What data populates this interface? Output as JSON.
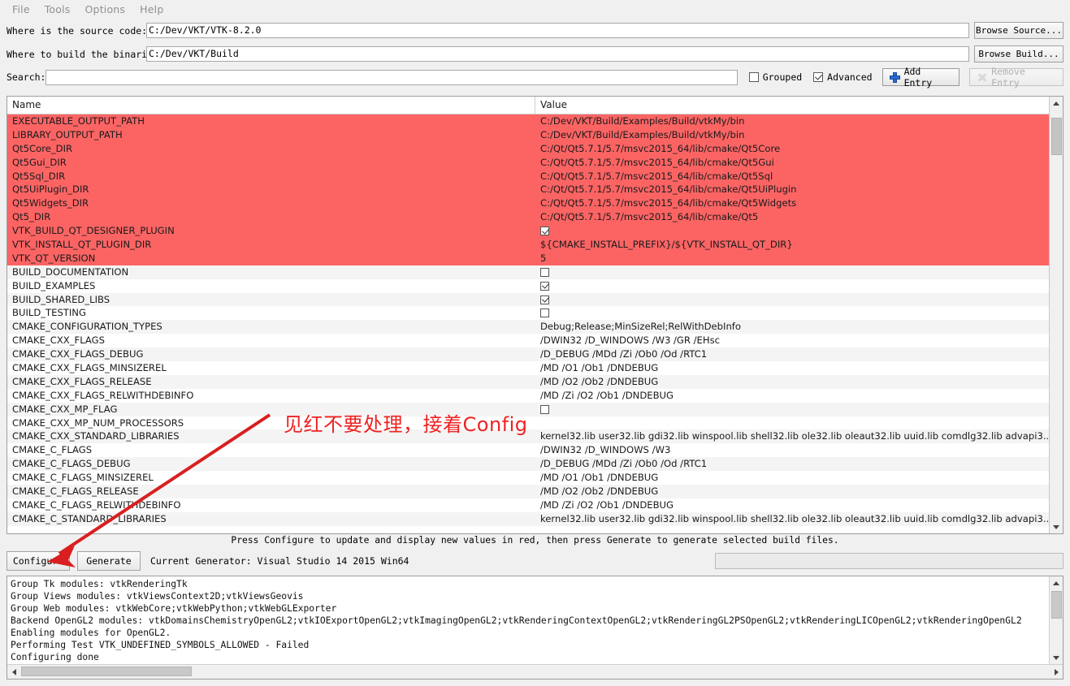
{
  "menu": {
    "items": [
      {
        "label": "File"
      },
      {
        "label": "Tools"
      },
      {
        "label": "Options"
      },
      {
        "label": "Help"
      }
    ]
  },
  "paths": {
    "source": {
      "label": "Where is the source code:",
      "value": "C:/Dev/VKT/VTK-8.2.0",
      "placeholder": "",
      "browse_label": "Browse Source..."
    },
    "build": {
      "label": "Where to build the binaries:",
      "value": "C:/Dev/VKT/Build",
      "placeholder": "",
      "browse_label": "Browse Build..."
    }
  },
  "search": {
    "label": "Search:",
    "value": "",
    "placeholder": "",
    "grouped_label": "Grouped",
    "grouped_checked": false,
    "advanced_label": "Advanced",
    "advanced_checked": true,
    "add_entry_label": "Add Entry",
    "remove_entry_label": "Remove Entry"
  },
  "table": {
    "columns": [
      "Name",
      "Value"
    ],
    "rows": [
      {
        "name": "EXECUTABLE_OUTPUT_PATH",
        "value": "C:/Dev/VKT/Build/Examples/Build/vtkMy/bin",
        "type": "text",
        "red": true
      },
      {
        "name": "LIBRARY_OUTPUT_PATH",
        "value": "C:/Dev/VKT/Build/Examples/Build/vtkMy/bin",
        "type": "text",
        "red": true
      },
      {
        "name": "Qt5Core_DIR",
        "value": "C:/Qt/Qt5.7.1/5.7/msvc2015_64/lib/cmake/Qt5Core",
        "type": "text",
        "red": true
      },
      {
        "name": "Qt5Gui_DIR",
        "value": "C:/Qt/Qt5.7.1/5.7/msvc2015_64/lib/cmake/Qt5Gui",
        "type": "text",
        "red": true
      },
      {
        "name": "Qt5Sql_DIR",
        "value": "C:/Qt/Qt5.7.1/5.7/msvc2015_64/lib/cmake/Qt5Sql",
        "type": "text",
        "red": true
      },
      {
        "name": "Qt5UiPlugin_DIR",
        "value": "C:/Qt/Qt5.7.1/5.7/msvc2015_64/lib/cmake/Qt5UiPlugin",
        "type": "text",
        "red": true
      },
      {
        "name": "Qt5Widgets_DIR",
        "value": "C:/Qt/Qt5.7.1/5.7/msvc2015_64/lib/cmake/Qt5Widgets",
        "type": "text",
        "red": true
      },
      {
        "name": "Qt5_DIR",
        "value": "C:/Qt/Qt5.7.1/5.7/msvc2015_64/lib/cmake/Qt5",
        "type": "text",
        "red": true
      },
      {
        "name": "VTK_BUILD_QT_DESIGNER_PLUGIN",
        "value": "",
        "type": "checkbox",
        "checked": true,
        "red": true
      },
      {
        "name": "VTK_INSTALL_QT_PLUGIN_DIR",
        "value": "${CMAKE_INSTALL_PREFIX}/${VTK_INSTALL_QT_DIR}",
        "type": "text",
        "red": true
      },
      {
        "name": "VTK_QT_VERSION",
        "value": "5",
        "type": "text",
        "red": true
      },
      {
        "name": "BUILD_DOCUMENTATION",
        "value": "",
        "type": "checkbox",
        "checked": false,
        "red": false
      },
      {
        "name": "BUILD_EXAMPLES",
        "value": "",
        "type": "checkbox",
        "checked": true,
        "red": false
      },
      {
        "name": "BUILD_SHARED_LIBS",
        "value": "",
        "type": "checkbox",
        "checked": true,
        "red": false
      },
      {
        "name": "BUILD_TESTING",
        "value": "",
        "type": "checkbox",
        "checked": false,
        "red": false
      },
      {
        "name": "CMAKE_CONFIGURATION_TYPES",
        "value": "Debug;Release;MinSizeRel;RelWithDebInfo",
        "type": "text",
        "red": false
      },
      {
        "name": "CMAKE_CXX_FLAGS",
        "value": " /DWIN32 /D_WINDOWS /W3 /GR /EHsc",
        "type": "text",
        "red": false
      },
      {
        "name": "CMAKE_CXX_FLAGS_DEBUG",
        "value": "/D_DEBUG /MDd /Zi /Ob0 /Od /RTC1",
        "type": "text",
        "red": false
      },
      {
        "name": "CMAKE_CXX_FLAGS_MINSIZEREL",
        "value": "/MD /O1 /Ob1 /DNDEBUG",
        "type": "text",
        "red": false
      },
      {
        "name": "CMAKE_CXX_FLAGS_RELEASE",
        "value": "/MD /O2 /Ob2 /DNDEBUG",
        "type": "text",
        "red": false
      },
      {
        "name": "CMAKE_CXX_FLAGS_RELWITHDEBINFO",
        "value": "/MD /Zi /O2 /Ob1 /DNDEBUG",
        "type": "text",
        "red": false
      },
      {
        "name": "CMAKE_CXX_MP_FLAG",
        "value": "",
        "type": "checkbox",
        "checked": false,
        "red": false
      },
      {
        "name": "CMAKE_CXX_MP_NUM_PROCESSORS",
        "value": "",
        "type": "text",
        "red": false
      },
      {
        "name": "CMAKE_CXX_STANDARD_LIBRARIES",
        "value": "kernel32.lib user32.lib gdi32.lib winspool.lib shell32.lib ole32.lib oleaut32.lib uuid.lib comdlg32.lib advapi3...",
        "type": "text",
        "red": false
      },
      {
        "name": "CMAKE_C_FLAGS",
        "value": " /DWIN32 /D_WINDOWS /W3",
        "type": "text",
        "red": false
      },
      {
        "name": "CMAKE_C_FLAGS_DEBUG",
        "value": "/D_DEBUG /MDd /Zi /Ob0 /Od /RTC1",
        "type": "text",
        "red": false
      },
      {
        "name": "CMAKE_C_FLAGS_MINSIZEREL",
        "value": "/MD /O1 /Ob1 /DNDEBUG",
        "type": "text",
        "red": false
      },
      {
        "name": "CMAKE_C_FLAGS_RELEASE",
        "value": "/MD /O2 /Ob2 /DNDEBUG",
        "type": "text",
        "red": false
      },
      {
        "name": "CMAKE_C_FLAGS_RELWITHDEBINFO",
        "value": "/MD /Zi /O2 /Ob1 /DNDEBUG",
        "type": "text",
        "red": false
      },
      {
        "name": "CMAKE_C_STANDARD_LIBRARIES",
        "value": "kernel32.lib user32.lib gdi32.lib winspool.lib shell32.lib ole32.lib oleaut32.lib uuid.lib comdlg32.lib advapi3...",
        "type": "text",
        "red": false
      }
    ]
  },
  "status": {
    "message": "Press Configure to update and display new values in red, then press Generate to generate selected build files."
  },
  "actions": {
    "configure_label": "Configure",
    "generate_label": "Generate",
    "generator_label": "Current Generator: Visual Studio 14 2015 Win64"
  },
  "log": {
    "lines": [
      "Group Tk modules: vtkRenderingTk",
      "Group Views modules: vtkViewsContext2D;vtkViewsGeovis",
      "Group Web modules: vtkWebCore;vtkWebPython;vtkWebGLExporter",
      "Backend OpenGL2 modules: vtkDomainsChemistryOpenGL2;vtkIOExportOpenGL2;vtkImagingOpenGL2;vtkRenderingContextOpenGL2;vtkRenderingGL2PSOpenGL2;vtkRenderingLICOpenGL2;vtkRenderingOpenGL2",
      "Enabling modules for OpenGL2.",
      "Performing Test VTK_UNDEFINED_SYMBOLS_ALLOWED - Failed",
      "Configuring done"
    ]
  },
  "annotation": {
    "text": "见红不要处理，接着Config",
    "color": "#ee2222"
  },
  "colors": {
    "modified_row": "#FC6464",
    "alt_row": "#f4f4f4",
    "window_bg": "#f0f0f0",
    "accent": "#2b6bd0"
  }
}
